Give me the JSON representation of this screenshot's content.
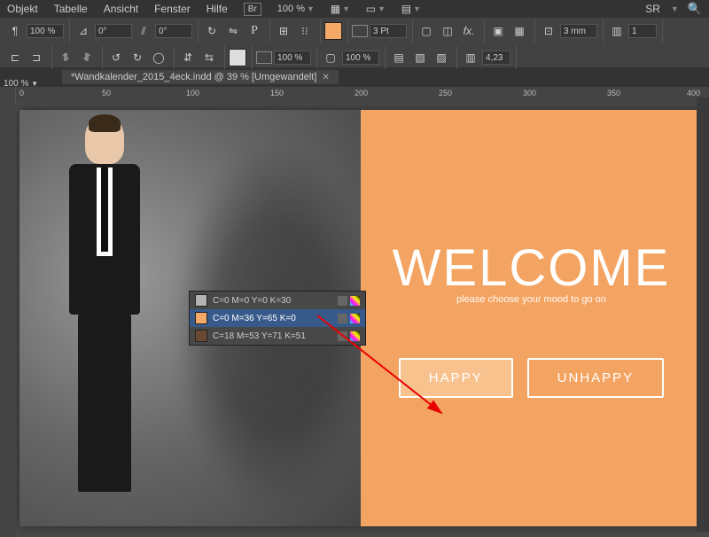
{
  "menu": {
    "items": [
      "Objekt",
      "Tabelle",
      "Ansicht",
      "Fenster",
      "Hilfe"
    ],
    "br": "Br",
    "zoom": "100 %",
    "lang": "SR"
  },
  "toolbar": {
    "pct1": "100 %",
    "deg1": "0°",
    "deg2": "0°",
    "stroke": "3 Pt",
    "pct2": "100 %",
    "pct3": "100 %",
    "mm": "3 mm",
    "n1": "1",
    "n2": "4,23"
  },
  "tabs": {
    "rulerZoom": "100 %",
    "doc": "*Wandkalender_2015_4eck.indd @ 39 % [Umgewandelt]"
  },
  "ruler": {
    "marks": [
      "0",
      "50",
      "100",
      "150",
      "200",
      "250",
      "300",
      "350",
      "400"
    ]
  },
  "swatches": [
    {
      "label": "C=0 M=0 Y=0 K=30",
      "color": "#b3b3b3"
    },
    {
      "label": "C=0 M=36 Y=65 K=0",
      "color": "#f4a968"
    },
    {
      "label": "C=18 M=53 Y=71 K=51",
      "color": "#6a4a32"
    }
  ],
  "page": {
    "welcome": "WELCOME",
    "sub": "please choose your mood to go on",
    "happy": "HAPPY",
    "unhappy": "UNHAPPY"
  }
}
